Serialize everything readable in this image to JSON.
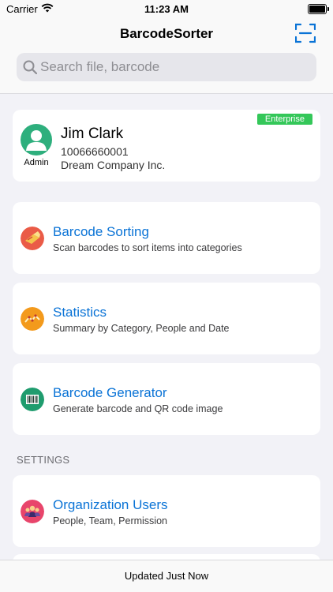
{
  "status_bar": {
    "carrier": "Carrier",
    "time": "11:23 AM"
  },
  "nav": {
    "title": "BarcodeSorter"
  },
  "search": {
    "placeholder": "Search file, barcode"
  },
  "profile": {
    "name": "Jim Clark",
    "id": "10066660001",
    "company": "Dream Company Inc.",
    "role": "Admin",
    "plan_badge": "Enterprise"
  },
  "menu": [
    {
      "title": "Barcode Sorting",
      "subtitle": "Scan barcodes to sort items into categories",
      "icon": "barcode-sorting-icon"
    },
    {
      "title": "Statistics",
      "subtitle": "Summary by Category, People and Date",
      "icon": "statistics-icon"
    },
    {
      "title": "Barcode Generator",
      "subtitle": "Generate barcode and QR code image",
      "icon": "barcode-generator-icon"
    }
  ],
  "settings": {
    "header": "SETTINGS",
    "items": [
      {
        "title": "Organization Users",
        "subtitle": "People, Team, Permission",
        "icon": "organization-users-icon"
      }
    ]
  },
  "footer": {
    "status": "Updated Just Now"
  },
  "colors": {
    "accent": "#0a73d6",
    "badge": "#34c759",
    "avatar": "#2eaf7d"
  }
}
